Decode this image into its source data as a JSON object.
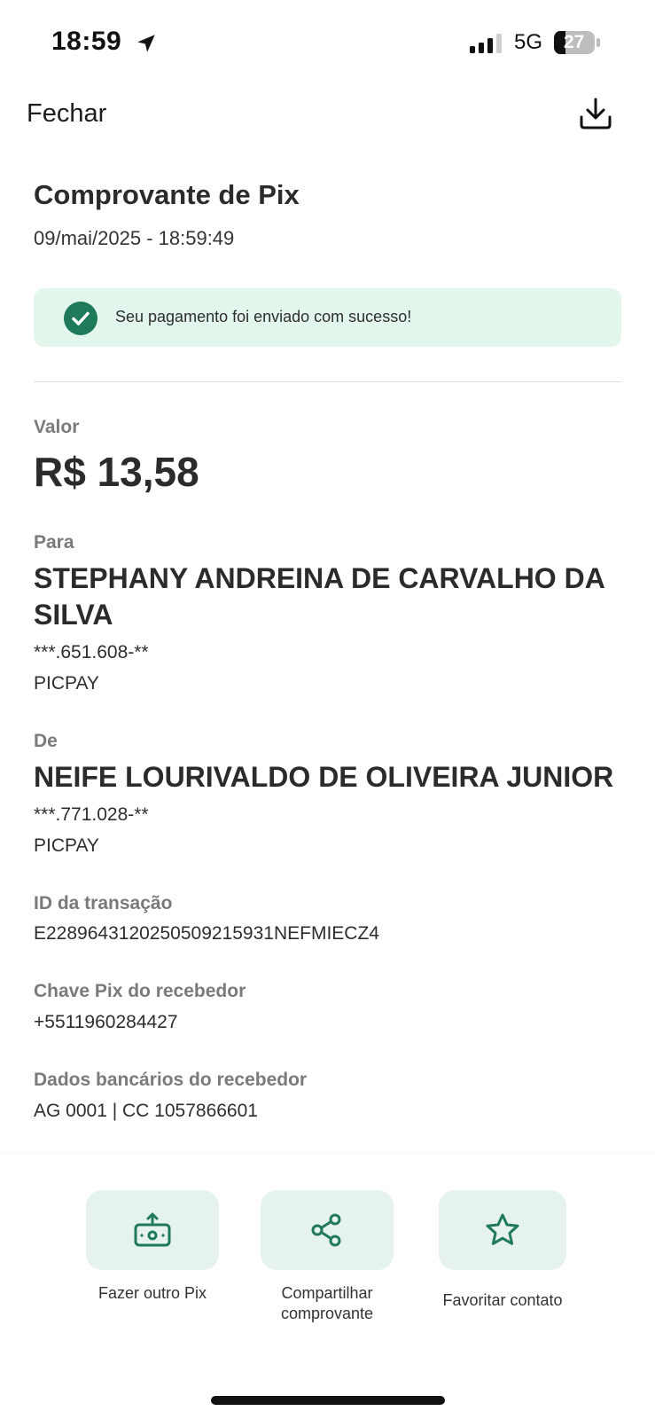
{
  "status_bar": {
    "time": "18:59",
    "network": "5G",
    "battery": "27"
  },
  "header": {
    "close_label": "Fechar"
  },
  "receipt": {
    "title": "Comprovante de Pix",
    "datetime": "09/mai/2025 - 18:59:49",
    "success_message": "Seu pagamento foi enviado com sucesso!"
  },
  "details": {
    "amount_label": "Valor",
    "amount_value": "R$ 13,58",
    "to_label": "Para",
    "to_name": "STEPHANY ANDREINA DE CARVALHO DA SILVA",
    "to_document": "***.651.608-**",
    "to_institution": "PICPAY",
    "from_label": "De",
    "from_name": "NEIFE LOURIVALDO DE OLIVEIRA JUNIOR",
    "from_document": "***.771.028-**",
    "from_institution": "PICPAY",
    "transaction_id_label": "ID da transação",
    "transaction_id": "E22896431202505092159​31NEFMIECZ4",
    "pix_key_label": "Chave Pix do recebedor",
    "pix_key": "+5511960284427",
    "bank_data_label": "Dados bancários do recebedor",
    "bank_data": "AG 0001 | CC 1057866601"
  },
  "actions": [
    {
      "label": "Fazer outro Pix",
      "icon": "money-transfer-icon"
    },
    {
      "label": "Compartilhar comprovante",
      "icon": "share-icon"
    },
    {
      "label": "Favoritar contato",
      "icon": "star-icon"
    }
  ],
  "colors": {
    "accent_green": "#1e7a58",
    "success_bg": "#e3f6ec",
    "action_bg": "#e6f2ee"
  }
}
